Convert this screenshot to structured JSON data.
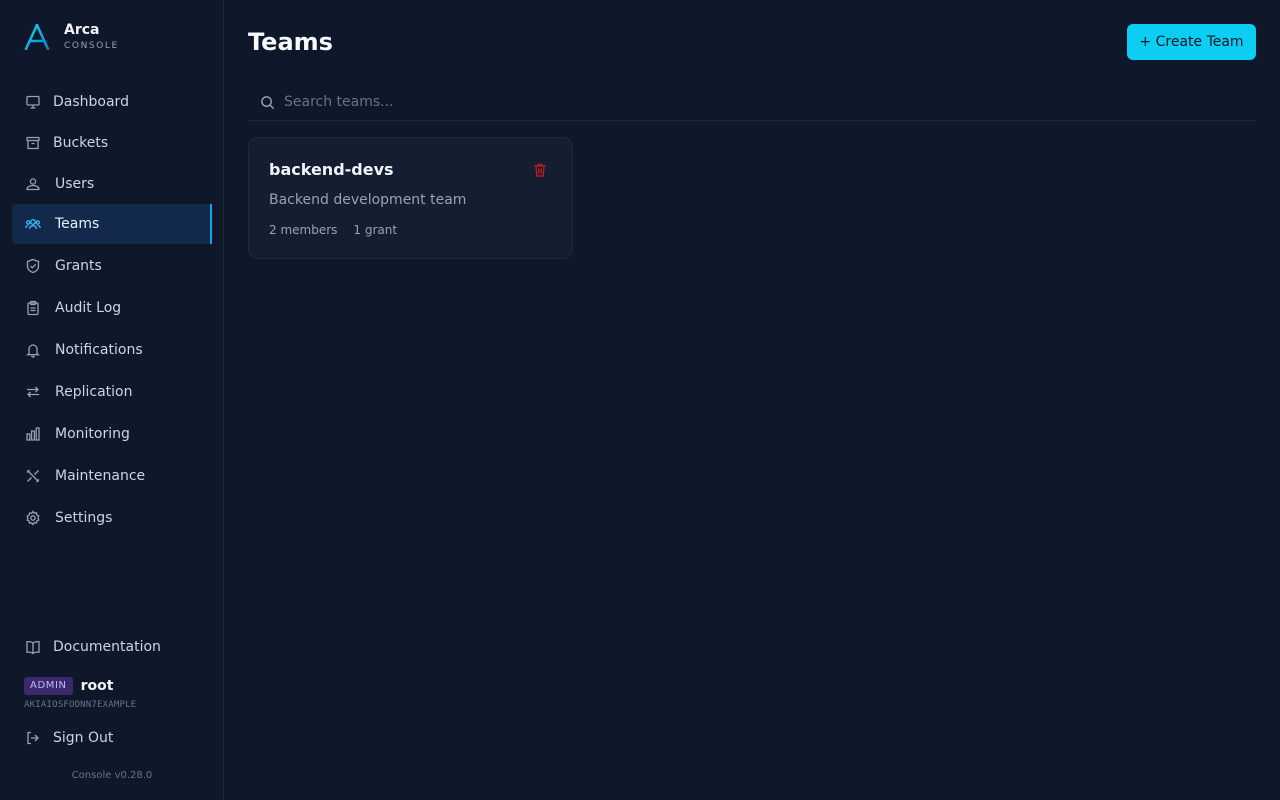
{
  "brand": {
    "name": "Arca",
    "sub": "CONSOLE",
    "accent": "#0ea5e9"
  },
  "sidebar": {
    "items": [
      {
        "label": "Dashboard",
        "icon": "monitor-icon"
      },
      {
        "label": "Buckets",
        "icon": "archive-icon"
      },
      {
        "label": "Users",
        "icon": "user-icon"
      },
      {
        "label": "Teams",
        "icon": "users-icon",
        "active": true
      },
      {
        "label": "Grants",
        "icon": "shield-icon"
      },
      {
        "label": "Audit Log",
        "icon": "clipboard-icon"
      },
      {
        "label": "Notifications",
        "icon": "bell-icon"
      },
      {
        "label": "Replication",
        "icon": "arrows-icon"
      },
      {
        "label": "Monitoring",
        "icon": "bar-chart-icon"
      },
      {
        "label": "Maintenance",
        "icon": "tools-icon"
      },
      {
        "label": "Settings",
        "icon": "gear-icon"
      }
    ],
    "documentation": "Documentation",
    "user": {
      "role": "ADMIN",
      "name": "root",
      "access_key": "AKIAIOSFODNN7EXAMPLE"
    },
    "sign_out": "Sign Out",
    "version": "Console v0.28.0"
  },
  "main": {
    "title": "Teams",
    "create_button": "+ Create Team",
    "search_placeholder": "Search teams...",
    "teams": [
      {
        "name": "backend-devs",
        "description": "Backend development team",
        "members": "2 members",
        "grants": "1 grant"
      }
    ]
  },
  "colors": {
    "background": "#0f172a",
    "primary_button": "#0ccdf2",
    "delete": "#b91c1c"
  }
}
